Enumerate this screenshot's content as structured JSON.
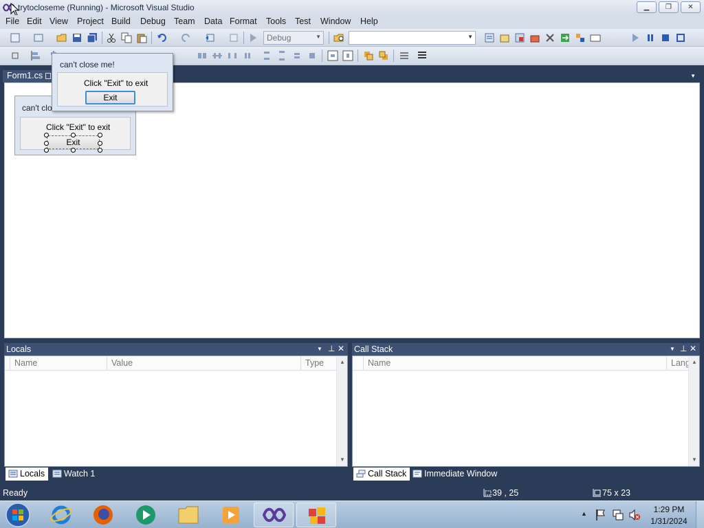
{
  "window": {
    "title": "trytocloseme (Running) - Microsoft Visual Studio",
    "controls": {
      "minimize": "▁",
      "restore": "❐",
      "close": "✕"
    }
  },
  "menu": [
    "File",
    "Edit",
    "View",
    "Project",
    "Build",
    "Debug",
    "Team",
    "Data",
    "Format",
    "Tools",
    "Test",
    "Window",
    "Help"
  ],
  "toolbar": {
    "configuration": "Debug",
    "find_value": ""
  },
  "document_tab": {
    "label": "Form1.cs"
  },
  "designer_form": {
    "title": "can't clo",
    "label": "Click \"Exit\" to exit",
    "button": "Exit"
  },
  "running_dialog": {
    "title": "can't close me!",
    "label": "Click \"Exit\" to exit",
    "button": "Exit"
  },
  "locals": {
    "title": "Locals",
    "columns": [
      "Name",
      "Value",
      "Type"
    ],
    "tabs": [
      "Locals",
      "Watch 1"
    ]
  },
  "callstack": {
    "title": "Call Stack",
    "columns": [
      "Name",
      "Lang"
    ],
    "tabs": [
      "Call Stack",
      "Immediate Window"
    ]
  },
  "statusbar": {
    "status": "Ready",
    "position": "39 , 25",
    "size": "75 x 23"
  },
  "tray": {
    "time": "1:29 PM",
    "date": "1/31/2024"
  },
  "colors": {
    "ide_background": "#2b3c59",
    "tool_header": "#3f5274",
    "chrome": "#d5dde9"
  }
}
